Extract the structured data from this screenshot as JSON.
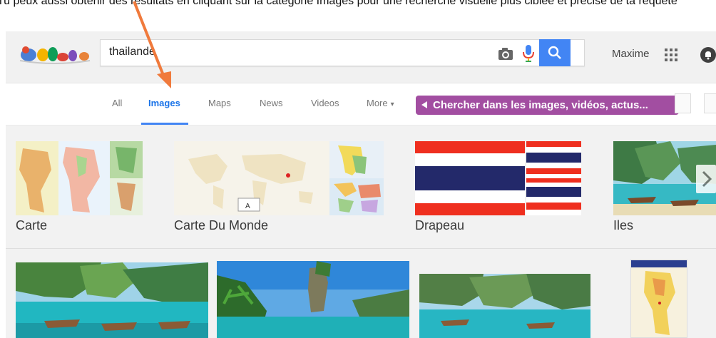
{
  "top_strip": {
    "caption": "Tu peux aussi obtenir des résultats en cliquant sur la catégorie Images pour une recherche visuelle plus ciblée et précise de ta requête"
  },
  "header": {
    "query": "thailande",
    "user_name": "Maxime"
  },
  "tabs": [
    {
      "label": "All"
    },
    {
      "label": "Images"
    },
    {
      "label": "Maps"
    },
    {
      "label": "News"
    },
    {
      "label": "Videos"
    },
    {
      "label": "More"
    }
  ],
  "callout": {
    "text": "Chercher dans les images, vidéos, actus..."
  },
  "categories": [
    {
      "label": "Carte"
    },
    {
      "label": "Carte Du Monde"
    },
    {
      "label": "Drapeau"
    },
    {
      "label": "Iles"
    }
  ],
  "colors": {
    "accent": "#4285f4",
    "callout_bg": "#a24ea1",
    "annotation_arrow": "#f07a3c",
    "thai_red": "#ef2f1f",
    "thai_blue": "#23296a"
  }
}
